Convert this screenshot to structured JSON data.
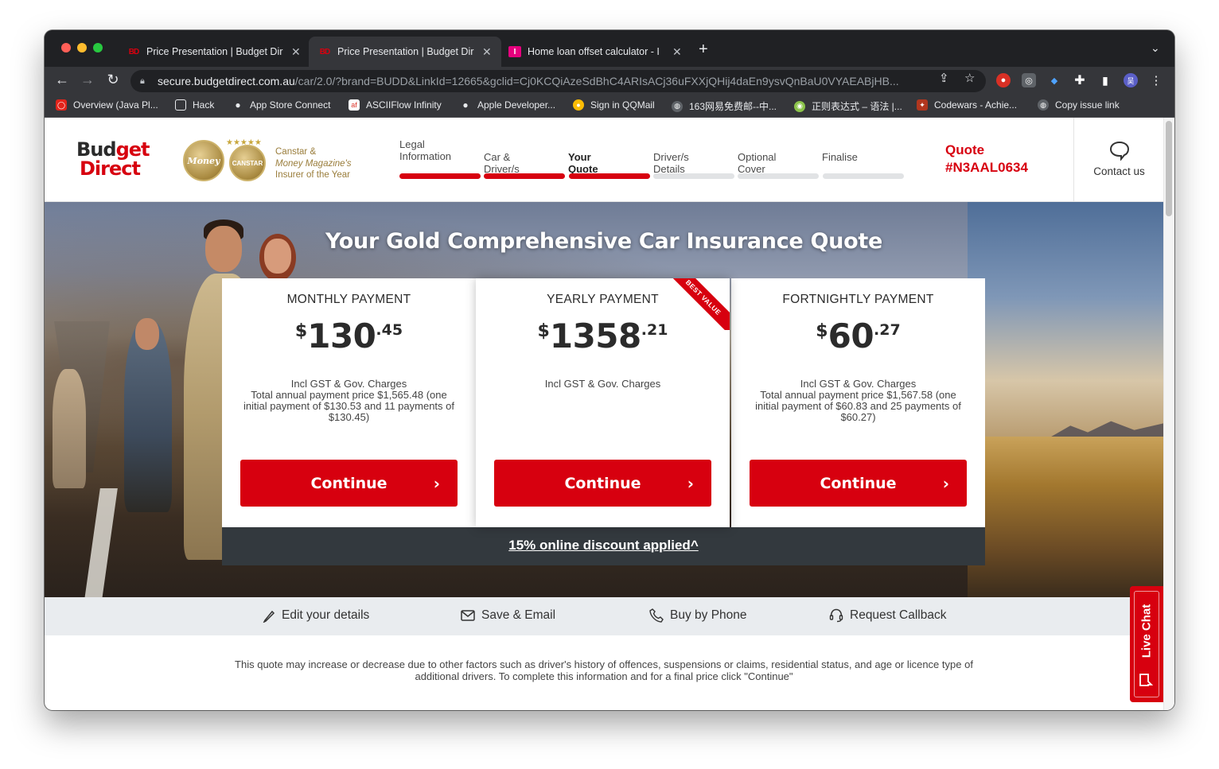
{
  "browser": {
    "tabs": [
      {
        "title": "Price Presentation | Budget Dir",
        "favicon": "BD",
        "active": false
      },
      {
        "title": "Price Presentation | Budget Dir",
        "favicon": "BD",
        "active": true
      },
      {
        "title": "Home loan offset calculator - I",
        "favicon": "I",
        "active": false
      }
    ],
    "url_host": "secure.budgetdirect.com.au",
    "url_path": "/car/2.0/?brand=BUDD&LinkId=12665&gclid=Cj0KCQiAzeSdBhC4ARIsACj36uFXXjQHij4daEn9ysvQnBaU0VYAEABjHB...",
    "avatar_initial": "吴",
    "bookmarks": [
      "Overview (Java Pl...",
      "Hack",
      "App Store Connect",
      "ASCIIFlow Infinity",
      "Apple Developer...",
      "Sign in QQMail",
      "163网易免费邮--中...",
      "正则表达式 – 语法 |...",
      "Codewars - Achie...",
      "Copy issue link"
    ]
  },
  "header": {
    "logo_line1_a": "Bud",
    "logo_line1_b": "get",
    "logo_line2": "Direct",
    "award_money": "Money",
    "award_canstar": "CANSTAR",
    "award_text_line1": "Canstar &",
    "award_text_line2_em": "Money Magazine's",
    "award_text_line3": "Insurer of the Year",
    "steps": [
      {
        "label_line1": "Legal",
        "label_line2": "Information",
        "done": true,
        "current": false
      },
      {
        "label_line1": "Car & Driver/s",
        "label_line2": "",
        "done": true,
        "current": false
      },
      {
        "label_line1": "Your Quote",
        "label_line2": "",
        "done": true,
        "current": true
      },
      {
        "label_line1": "Driver/s Details",
        "label_line2": "",
        "done": false,
        "current": false
      },
      {
        "label_line1": "Optional Cover",
        "label_line2": "",
        "done": false,
        "current": false
      },
      {
        "label_line1": "Finalise",
        "label_line2": "",
        "done": false,
        "current": false
      }
    ],
    "quote_label": "Quote",
    "quote_number": "#N3AAL0634",
    "contact_label": "Contact us"
  },
  "hero": {
    "title": "Your Gold Comprehensive Car Insurance Quote"
  },
  "plans": [
    {
      "title": "MONTHLY PAYMENT",
      "currency": "$",
      "whole": "130",
      "cents": ".45",
      "incl": "Incl GST & Gov. Charges",
      "detail": "Total annual payment price $1,565.48 (one initial payment of $130.53 and 11 payments of $130.45)",
      "button": "Continue"
    },
    {
      "title": "YEARLY PAYMENT",
      "currency": "$",
      "whole": "1358",
      "cents": ".21",
      "incl": "Incl GST & Gov. Charges",
      "detail": "",
      "button": "Continue",
      "ribbon": "BEST VALUE"
    },
    {
      "title": "FORTNIGHTLY PAYMENT",
      "currency": "$",
      "whole": "60",
      "cents": ".27",
      "incl": "Incl GST & Gov. Charges",
      "detail": "Total annual payment price $1,567.58 (one initial payment of $60.83 and 25 payments of $60.27)",
      "button": "Continue"
    }
  ],
  "discount": "15% online discount applied^",
  "actions": {
    "edit": "Edit your details",
    "save": "Save & Email",
    "phone": "Buy by Phone",
    "callback": "Request Callback"
  },
  "disclaimer": "This quote may increase or decrease due to other factors such as driver's history of offences, suspensions or claims, residential status, and age or licence type of additional drivers. To complete this information and for a final price click \"Continue\"",
  "live_chat": "Live Chat",
  "colors": {
    "brand_red": "#d7000f",
    "dark_bar": "#33393e",
    "progress_inactive": "#e1e3e5"
  }
}
